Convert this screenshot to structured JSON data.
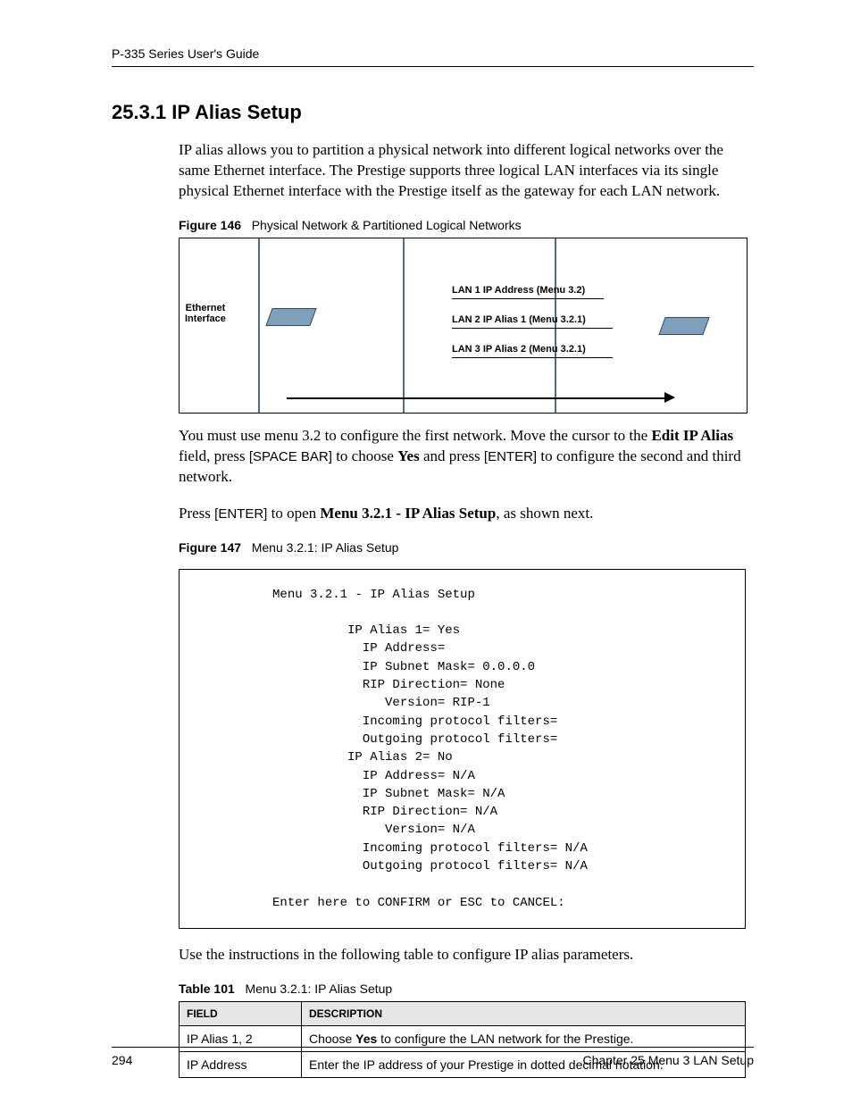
{
  "runhead": "P-335 Series User's Guide",
  "section_heading": "25.3.1  IP Alias Setup",
  "para1": "IP alias allows you to partition a physical network into different logical networks over the same Ethernet interface. The Prestige supports three logical LAN interfaces via its single physical Ethernet interface with the Prestige itself as the gateway for each LAN network.",
  "fig146_label": "Figure 146",
  "fig146_title": "Physical Network & Partitioned Logical Networks",
  "diagram": {
    "eth_label_line1": "Ethernet",
    "eth_label_line2": "Interface",
    "lan1": "LAN 1 IP Address (Menu 3.2)",
    "lan2": "LAN 2 IP Alias 1 (Menu 3.2.1)",
    "lan3": "LAN 3 IP Alias 2 (Menu 3.2.1)"
  },
  "para2_pre": "You must use menu 3.2 to configure the first network. Move the cursor to the ",
  "para2_bold1": "Edit IP Alias",
  "para2_mid1": " field, press ",
  "para2_sans1": "[SPACE BAR]",
  "para2_mid2": " to choose ",
  "para2_bold2": "Yes",
  "para2_mid3": " and press ",
  "para2_sans2": "[ENTER]",
  "para2_post": " to configure the second and third network.",
  "para3_pre": "Press ",
  "para3_sans": "[ENTER]",
  "para3_mid": " to open ",
  "para3_bold": "Menu 3.2.1 - IP Alias Setup",
  "para3_post": ", as shown next.",
  "fig147_label": "Figure 147",
  "fig147_title": "Menu 3.2.1: IP Alias Setup",
  "menu_text": "          Menu 3.2.1 - IP Alias Setup\n\n                    IP Alias 1= Yes\n                      IP Address=\n                      IP Subnet Mask= 0.0.0.0\n                      RIP Direction= None\n                         Version= RIP-1\n                      Incoming protocol filters=\n                      Outgoing protocol filters=\n                    IP Alias 2= No\n                      IP Address= N/A\n                      IP Subnet Mask= N/A\n                      RIP Direction= N/A\n                         Version= N/A\n                      Incoming protocol filters= N/A\n                      Outgoing protocol filters= N/A\n\n          Enter here to CONFIRM or ESC to CANCEL:",
  "para4": "Use the instructions in the following table to configure IP alias parameters.",
  "table101_label": "Table 101",
  "table101_title": "Menu 3.2.1: IP Alias Setup",
  "table": {
    "head_field": "FIELD",
    "head_desc": "DESCRIPTION",
    "rows": [
      {
        "field": "IP Alias 1, 2",
        "desc_pre": "Choose ",
        "desc_bold": "Yes",
        "desc_post": " to configure the LAN network for the Prestige."
      },
      {
        "field": "IP Address",
        "desc_pre": "Enter the IP address of your Prestige in dotted decimal notation.",
        "desc_bold": "",
        "desc_post": ""
      }
    ]
  },
  "footer_page": "294",
  "footer_chapter": "Chapter 25 Menu 3 LAN Setup"
}
